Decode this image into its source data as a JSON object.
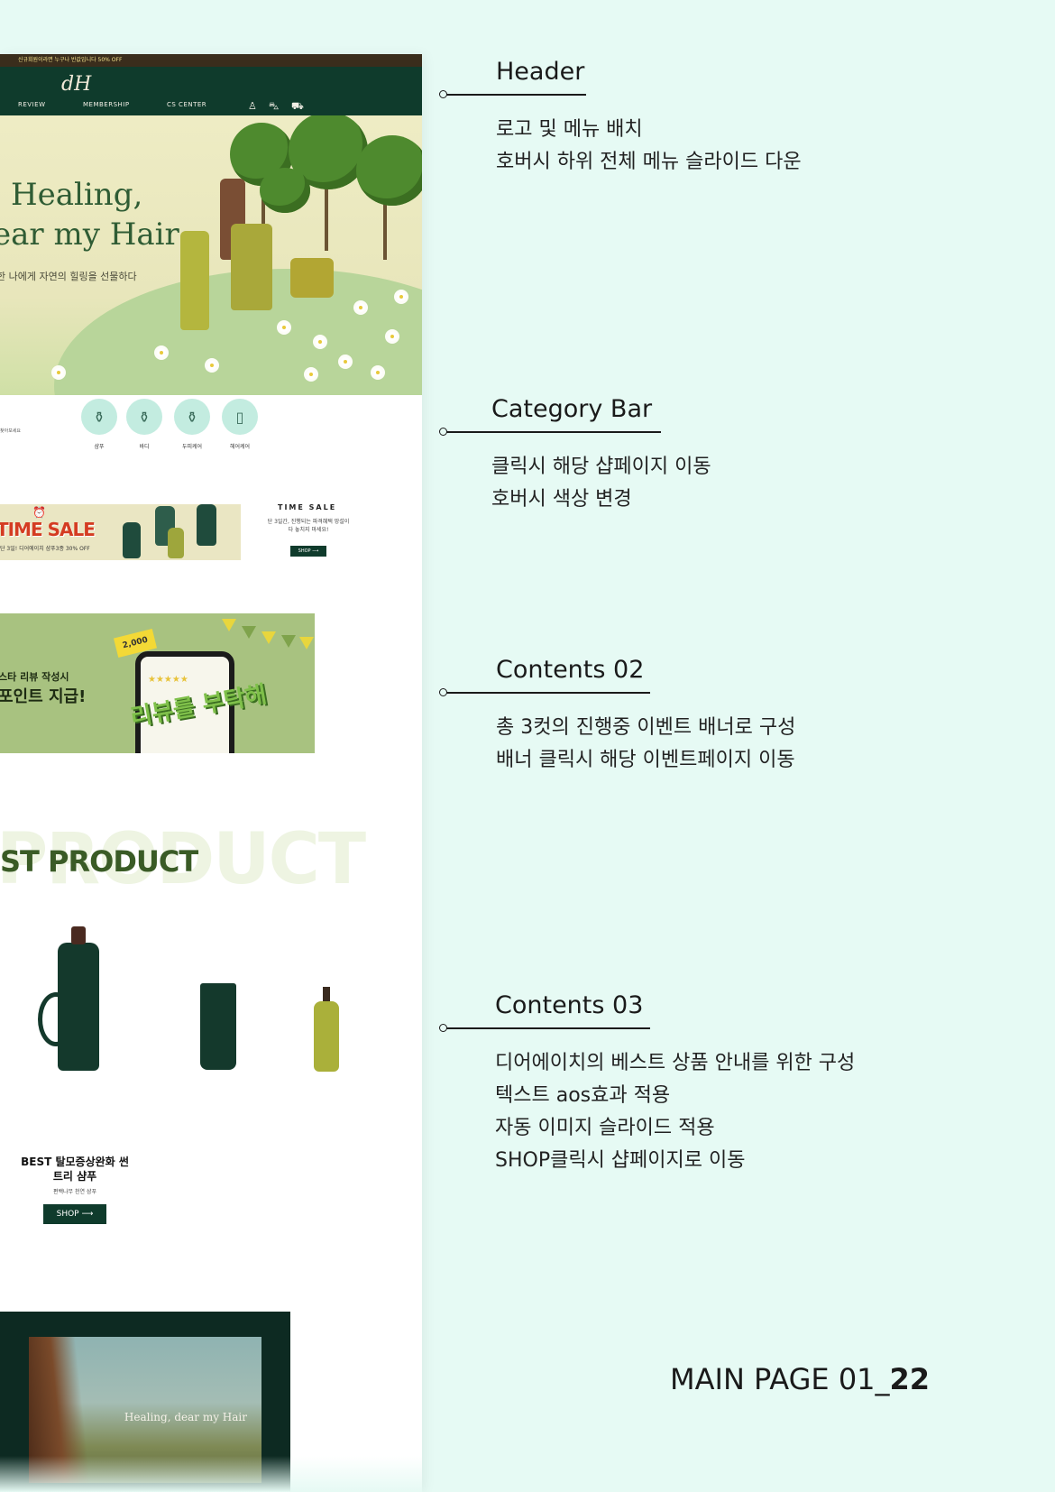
{
  "mockup": {
    "promo": "신규회원이라면 누구나 반값입니다 50% OFF",
    "logo": "dH",
    "nav": [
      "REVIEW",
      "MEMBERSHIP",
      "CS CENTER"
    ],
    "hero": {
      "line1": "Healing,",
      "line2": "ear my Hair",
      "sub": "한 나에게 자연의 힐링을 선물하다"
    },
    "category": {
      "hint": "찾아보세요",
      "items": [
        "샴푸",
        "바디",
        "두피케어",
        "헤어케어"
      ]
    },
    "timesale": {
      "banner_title": "TIME SALE",
      "banner_sub": "단 3일! 디어에이치 샴푸3종 30% OFF",
      "side_title": "TIME SALE",
      "side_desc": "단 3일간, 진행되는 파격혜택 망설이다 놓치지 마세요!",
      "shop": "SHOP ⟶"
    },
    "review": {
      "line1": "스타 리뷰 작성시",
      "line2": "포인트 지급!",
      "tag": "2,000",
      "phone_text": "리뷰를 부탁해"
    },
    "best": {
      "ghost": "PRODUCT",
      "title": "ST PRODUCT",
      "name": "BEST 탈모증상완화 썬트리 샴푸",
      "desc": "편백나무 천연 샴푸",
      "shop": "SHOP ⟶"
    },
    "video": {
      "text": "Healing, dear my Hair"
    }
  },
  "annotations": [
    {
      "title": "Header",
      "desc": [
        "로고 및 메뉴 배치",
        "호버시 하위 전체 메뉴 슬라이드 다운"
      ]
    },
    {
      "title": "Category Bar",
      "desc": [
        "클릭시 해당 샵페이지 이동",
        "호버시 색상 변경"
      ]
    },
    {
      "title": "Contents 02",
      "desc": [
        "총 3컷의 진행중 이벤트 배너로 구성",
        "배너 클릭시 해당 이벤트페이지 이동"
      ]
    },
    {
      "title": "Contents 03",
      "desc": [
        "디어에이치의 베스트 상품 안내를 위한 구성",
        "텍스트 aos효과 적용",
        "자동 이미지 슬라이드 적용",
        "SHOP클릭시 샵페이지로 이동"
      ]
    }
  ],
  "page_label": {
    "prefix": "MAIN PAGE 01_",
    "number": "22"
  },
  "colors": {
    "background": "#e6faf4",
    "brand_green": "#0f3b2c",
    "accent_olive": "#a8c280"
  }
}
